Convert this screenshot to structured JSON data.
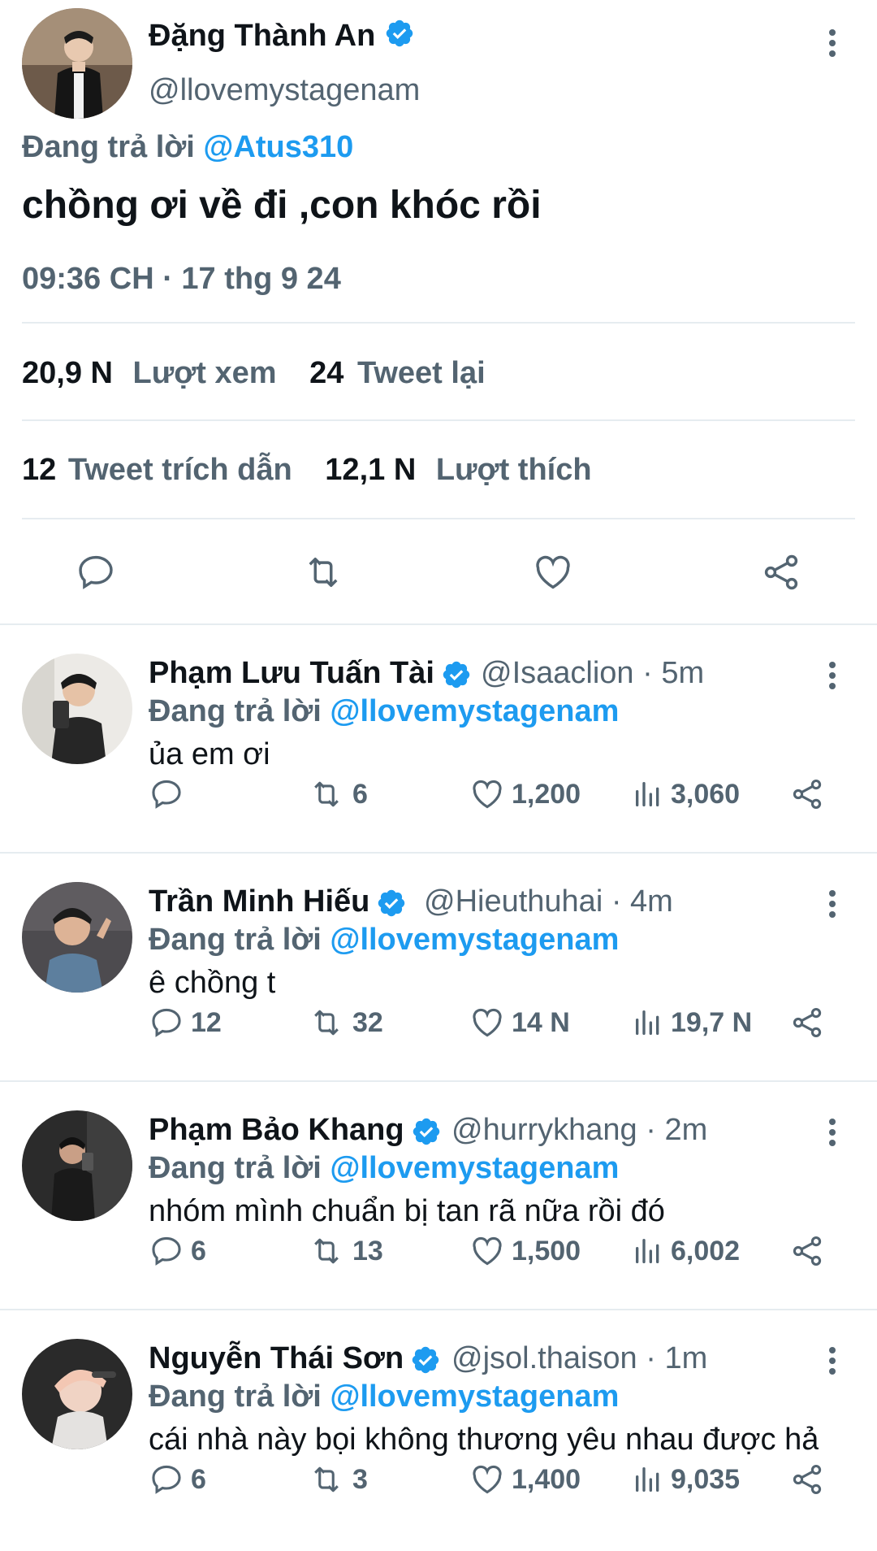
{
  "main_tweet": {
    "author_name": "Đặng Thành An",
    "handle": "@llovemystagenam",
    "replying_label": "Đang trả lời",
    "replying_to": "@Atus310",
    "text": "chồng ơi về đi ,con khóc rồi",
    "timestamp": "09:36 CH · 17 thg 9 24",
    "stats": {
      "views_count": "20,9 N",
      "views_label": "Lượt xem",
      "retweets_count": "24",
      "retweets_label": "Tweet lại",
      "quotes_count": "12",
      "quotes_label": "Tweet trích dẫn",
      "likes_count": "12,1 N",
      "likes_label": "Lượt thích"
    }
  },
  "replies": [
    {
      "name": "Phạm Lưu Tuấn Tài",
      "handle": "@Isaaclion",
      "time": "· 5m",
      "replying_label": "Đang trả lời",
      "replying_to": "@llovemystagenam",
      "text": "ủa em ơi",
      "reply_count": "",
      "retweet_count": "6",
      "like_count": "1,200",
      "view_count": "3,060"
    },
    {
      "name": "Trần Minh Hiếu",
      "handle": "@Hieuthuhai",
      "time": "· 4m",
      "replying_label": "Đang trả lời",
      "replying_to": "@llovemystagenam",
      "text": "ê chồng t",
      "reply_count": "12",
      "retweet_count": "32",
      "like_count": "14 N",
      "view_count": "19,7 N"
    },
    {
      "name": "Phạm Bảo Khang",
      "handle": "@hurrykhang",
      "time": "· 2m",
      "replying_label": "Đang trả lời",
      "replying_to": "@llovemystagenam",
      "text": "nhóm mình chuẩn bị tan rã nữa rồi đó",
      "reply_count": "6",
      "retweet_count": "13",
      "like_count": "1,500",
      "view_count": "6,002"
    },
    {
      "name": "Nguyễn Thái Sơn",
      "handle": "@jsol.thaison",
      "time": "· 1m",
      "replying_label": "Đang trả lời",
      "replying_to": "@llovemystagenam",
      "text": "cái nhà này bọi không thương yêu nhau được hả",
      "reply_count": "6",
      "retweet_count": "3",
      "like_count": "1,400",
      "view_count": "9,035"
    }
  ],
  "colors": {
    "accent": "#1d9bf0",
    "secondary_text": "#536471",
    "primary_text": "#0f1419",
    "divider": "#e6ecf0"
  },
  "icons": [
    "verified-badge-icon",
    "more-options-icon",
    "reply-icon",
    "retweet-icon",
    "like-icon",
    "share-icon",
    "views-icon",
    "avatar"
  ]
}
